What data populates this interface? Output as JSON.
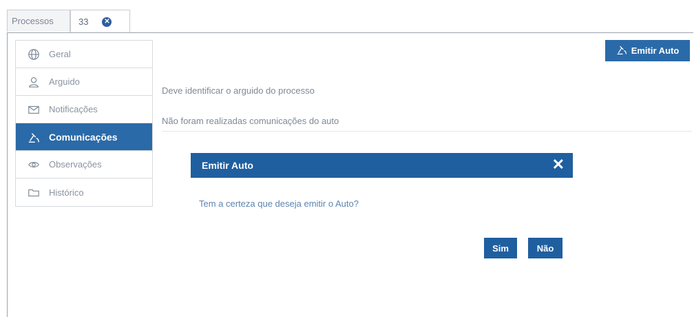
{
  "tabs": [
    {
      "label": "Processos"
    },
    {
      "label": "33",
      "close_icon": "close-circle-icon"
    }
  ],
  "sidebar": {
    "items": [
      {
        "label": "Geral",
        "icon": "globe-icon"
      },
      {
        "label": "Arguido",
        "icon": "user-icon"
      },
      {
        "label": "Notificações",
        "icon": "envelope-icon"
      },
      {
        "label": "Comunicações",
        "icon": "gavel-icon",
        "active": true
      },
      {
        "label": "Observações",
        "icon": "eye-icon"
      },
      {
        "label": "Histórico",
        "icon": "folder-icon"
      }
    ]
  },
  "toolbar": {
    "emit_label": "Emitir Auto",
    "emit_icon": "gavel-icon"
  },
  "main": {
    "messages": [
      "Deve identificar o arguido do processo",
      "Não foram realizadas comunicações do auto"
    ]
  },
  "modal": {
    "title": "Emitir Auto",
    "close": "✕",
    "text": "Tem a certeza que deseja emitir o Auto?",
    "yes_label": "Sim",
    "no_label": "Não"
  },
  "colors": {
    "accent": "#2a6aa8",
    "modal_header": "#1f5fa0"
  }
}
